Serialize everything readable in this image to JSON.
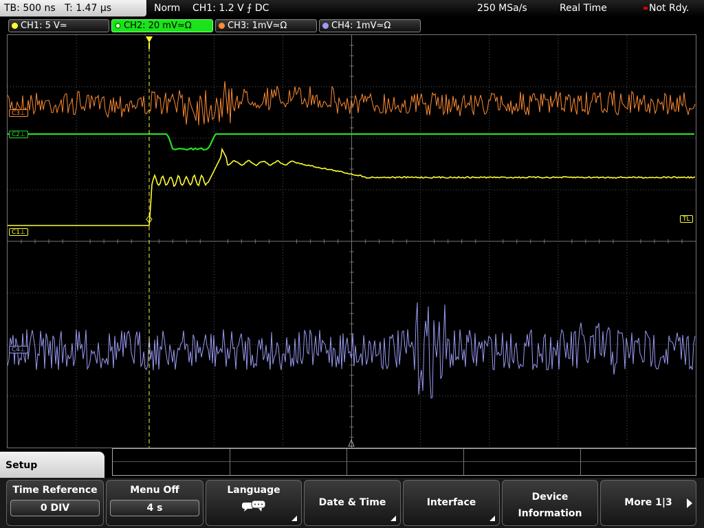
{
  "status": {
    "timebase": "TB: 500 ns   T: 1.47 µs",
    "mode": "Norm",
    "trigger": "CH1: 1.2 V ⨍ DC",
    "sample_rate": "250 MSa/s",
    "acq_mode": "Real Time",
    "state": "Not Rdy."
  },
  "channels": [
    {
      "label": "CH1: 5 V≃",
      "color": "#ffff33",
      "active": false
    },
    {
      "label": "CH2: 20 mV≃Ω",
      "color": "#23e023",
      "active": true
    },
    {
      "label": "CH3: 1mV≃Ω",
      "color": "#ff8c32",
      "active": false
    },
    {
      "label": "CH4: 1mV≃Ω",
      "color": "#9b9bf5",
      "active": false
    }
  ],
  "markers": {
    "c1": "C1⊥",
    "c2": "C2⊥",
    "c3": "C3⊥",
    "c4": "C4⊥",
    "trigger_level": "TL"
  },
  "menu": {
    "title": "Setup",
    "softkeys": [
      {
        "title": "Time Reference",
        "value": "0 DIV"
      },
      {
        "title": "Menu Off",
        "value": "4 s"
      },
      {
        "title": "Language",
        "icon": "speech-bubble-icon"
      },
      {
        "title": "Date & Time"
      },
      {
        "title": "Interface"
      },
      {
        "title_line1": "Device",
        "title_line2": "Information"
      },
      {
        "title": "More 1|3"
      }
    ]
  },
  "colors": {
    "ch1": "#ffff33",
    "ch2": "#23e023",
    "ch3": "#ff8c32",
    "ch4": "#9b9bf5",
    "grid": "#5a5a5a"
  }
}
